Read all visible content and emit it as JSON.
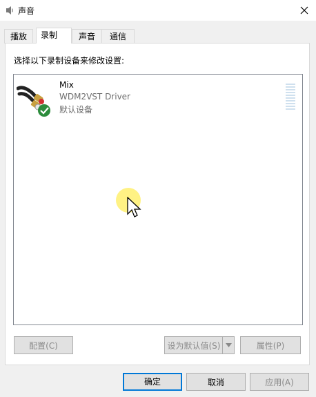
{
  "window": {
    "title": "声音"
  },
  "tabs": [
    {
      "label": "播放"
    },
    {
      "label": "录制"
    },
    {
      "label": "声音"
    },
    {
      "label": "通信"
    }
  ],
  "panel": {
    "instruction": "选择以下录制设备来修改设置:"
  },
  "devices": [
    {
      "name": "Mix",
      "driver": "WDM2VST Driver",
      "status": "默认设备",
      "icon": "audio-cable-icon",
      "status_icon": "green-check-icon"
    }
  ],
  "buttons": {
    "configure": "配置(C)",
    "set_default": "设为默认值(S)",
    "properties": "属性(P)",
    "ok": "确定",
    "cancel": "取消",
    "apply": "应用(A)"
  },
  "colors": {
    "accent": "#0078d7",
    "check": "#2c8c3c",
    "highlight": "#fff06e"
  }
}
